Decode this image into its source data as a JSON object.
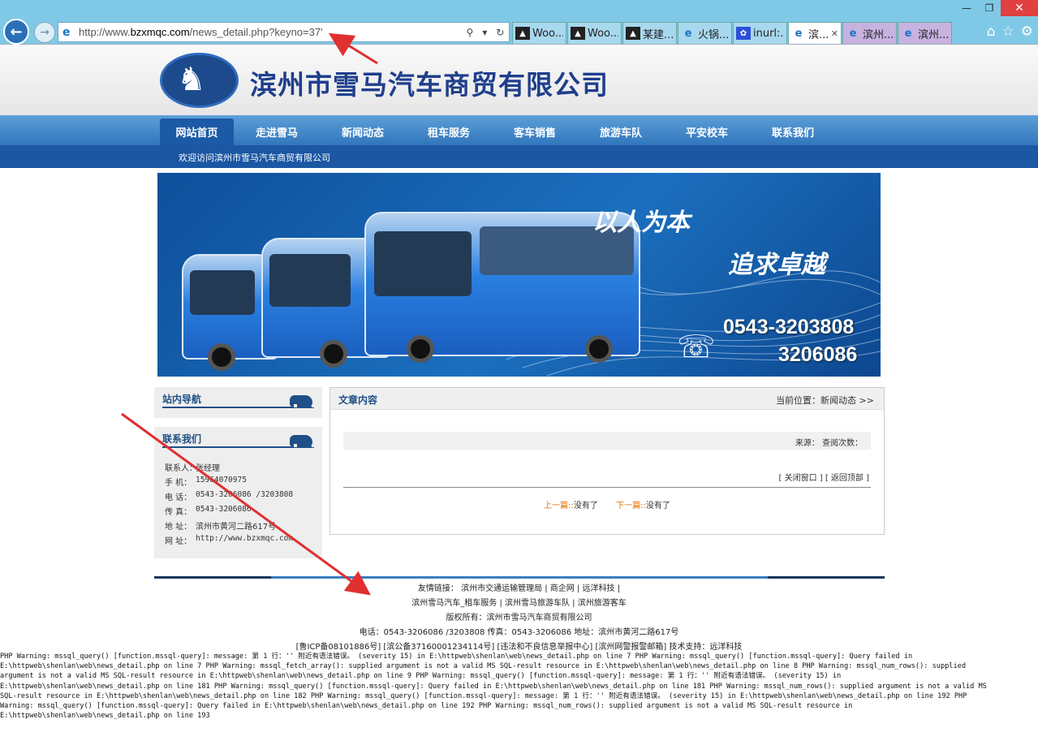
{
  "browser": {
    "url_prefix": "http://www.",
    "url_domain": "bzxmqc.com",
    "url_path": "/news_detail.php?keyno=37'",
    "tabs": [
      {
        "label": "Woo...",
        "icon": "woo-icon",
        "active": false
      },
      {
        "label": "Woo...",
        "icon": "woo-icon",
        "active": false
      },
      {
        "label": "某建...",
        "icon": "woo-icon",
        "active": false
      },
      {
        "label": "火锅...",
        "icon": "ie-icon",
        "active": false
      },
      {
        "label": "inurl:...",
        "icon": "baidu-paw-icon",
        "active": false
      },
      {
        "label": "滨...",
        "icon": "ie-icon",
        "active": true
      },
      {
        "label": "滨州...",
        "icon": "ie-icon",
        "active": false
      },
      {
        "label": "滨州...",
        "icon": "ie-icon",
        "active": false
      }
    ]
  },
  "header": {
    "company_name": "滨州市雪马汽车商贸有限公司"
  },
  "menu": [
    "网站首页",
    "走进雪马",
    "新闻动态",
    "租车服务",
    "客车销售",
    "旅游车队",
    "平安校车",
    "联系我们"
  ],
  "welcome": "欢迎访问滨州市雪马汽车商贸有限公司",
  "banner": {
    "slogan1": "以人为本",
    "slogan2": "追求卓越",
    "phone1": "0543-3203808",
    "phone2": "3206086"
  },
  "sidebar": {
    "nav_title": "站内导航",
    "contact_title": "联系我们",
    "contact": [
      {
        "label": "联系人：",
        "value": "张经理"
      },
      {
        "label": "手  机：",
        "value": "15964070975"
      },
      {
        "label": "电  话：",
        "value": "0543-3206086 /3203808"
      },
      {
        "label": "传  真：",
        "value": "0543-3206086"
      },
      {
        "label": "地  址：",
        "value": "滨州市黄河二路617号"
      },
      {
        "label": "网  址：",
        "value": "http://www.bzxmqc.com"
      }
    ]
  },
  "article": {
    "title": "文章内容",
    "location": "当前位置：新闻动态 >>",
    "source": "来源：  查阅次数：",
    "actions": "[ 关闭窗口 ] [ 返回顶部 ]",
    "prev_label": "上一篇::",
    "prev_value": "没有了",
    "next_label": "下一篇::",
    "next_value": "没有了"
  },
  "footer": {
    "links_label": "友情链接：",
    "links_row1": "滨州市交通运输管理局  |  商企网  |  远洋科技  |",
    "links_row2": "滨州雪马汽车_租车服务  |  滨州雪马旅游车队  |  滨州旅游客车",
    "copyright": "版权所有：滨州市雪马汽车商贸有限公司",
    "contact_line": "电话：0543-3206086 /3203808  传真：0543-3206086  地址：滨州市黄河二路617号",
    "icp_line": "[鲁ICP备08101886号] [滨公备37160001234114号] [违法和不良信息举报中心] [滨州网警报警邮箱] 技术支持：远洋科技"
  },
  "warnings": [
    "PHP Warning: mssql_query() [function.mssql-query]: message: 第 1 行：'' 附近有语法错误。 (severity 15) in E:\\httpweb\\shenlan\\web\\news_detail.php on line 7 PHP Warning: mssql_query() [function.mssql-query]: Query failed in",
    "E:\\httpweb\\shenlan\\web\\news_detail.php on line 7 PHP Warning: mssql_fetch_array(): supplied argument is not a valid MS SQL-result resource in E:\\httpweb\\shenlan\\web\\news_detail.php on line 8 PHP Warning: mssql_num_rows(): supplied",
    "argument is not a valid MS SQL-result resource in E:\\httpweb\\shenlan\\web\\news_detail.php on line 9 PHP Warning: mssql_query() [function.mssql-query]: message: 第 1 行：'' 附近有语法错误。 (severity 15) in",
    "E:\\httpweb\\shenlan\\web\\news_detail.php on line 181 PHP Warning: mssql_query() [function.mssql-query]: Query failed in E:\\httpweb\\shenlan\\web\\news_detail.php on line 181 PHP Warning: mssql_num_rows(): supplied argument is not a valid MS",
    "SQL-result resource in E:\\httpweb\\shenlan\\web\\news_detail.php on line 182 PHP Warning: mssql_query() [function.mssql-query]: message: 第 1 行：'' 附近有语法错误。 (severity 15) in E:\\httpweb\\shenlan\\web\\news_detail.php on line 192 PHP",
    "Warning: mssql_query() [function.mssql-query]: Query failed in E:\\httpweb\\shenlan\\web\\news_detail.php on line 192 PHP Warning: mssql_num_rows(): supplied argument is not a valid MS SQL-result resource in",
    "E:\\httpweb\\shenlan\\web\\news_detail.php on line 193"
  ],
  "colors": {
    "nav_blue": "#3176bd",
    "brand_blue": "#1f3f8c",
    "link_orange": "#e07000",
    "annotation_red": "#e03030"
  }
}
